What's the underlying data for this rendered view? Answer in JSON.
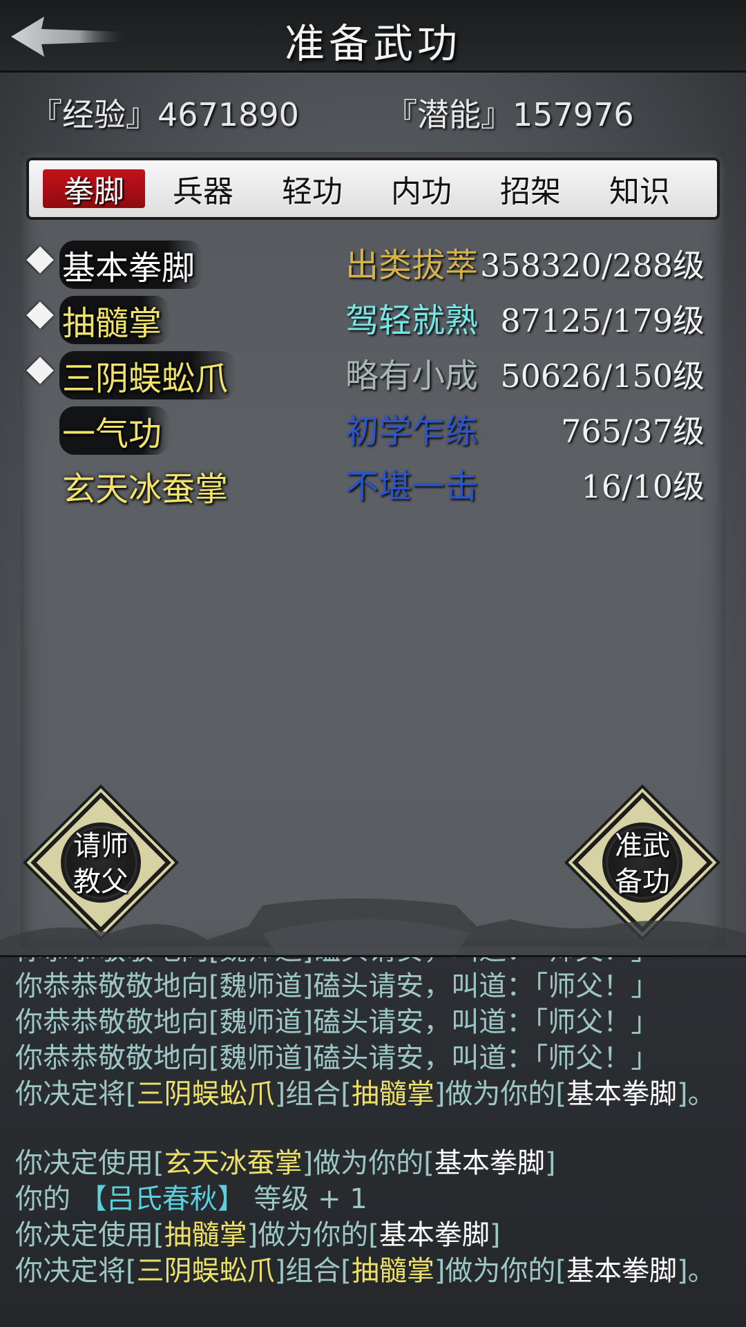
{
  "header": {
    "title": "准备武功",
    "back_icon": "back-arrow-icon"
  },
  "stats": {
    "experience": "『经验』4671890",
    "potential": "『潜能』157976"
  },
  "tabs": [
    {
      "label": "拳脚",
      "active": true
    },
    {
      "label": "兵器",
      "active": false
    },
    {
      "label": "轻功",
      "active": false
    },
    {
      "label": "内功",
      "active": false
    },
    {
      "label": "招架",
      "active": false
    },
    {
      "label": "知识",
      "active": false
    }
  ],
  "skills": [
    {
      "name": "基本拳脚",
      "rank": "出类拔萃",
      "level": "358320/288级",
      "marked": true,
      "name_color": "#ffffff",
      "rank_color": "#d6b24a"
    },
    {
      "name": "抽髓掌",
      "rank": "驾轻就熟",
      "level": "87125/179级",
      "marked": true,
      "name_color": "#f1e36a",
      "rank_color": "#76e6e6"
    },
    {
      "name": "三阴蜈蚣爪",
      "rank": "略有小成",
      "level": "50626/150级",
      "marked": true,
      "name_color": "#f1e36a",
      "rank_color": "#a8b7b6"
    },
    {
      "name": "一气功",
      "rank": "初学乍练",
      "level": "765/37级",
      "marked": false,
      "name_color": "#f1e36a",
      "rank_color": "#2f55c9"
    },
    {
      "name": "玄天冰蚕掌",
      "rank": "不堪一击",
      "level": "16/10级",
      "marked": false,
      "name_color": "#f1e36a",
      "rank_color": "#2b55c7"
    }
  ],
  "buttons": {
    "teacher_line1": "请师",
    "teacher_line2": "教父",
    "prepare_line1": "准武",
    "prepare_line2": "备功"
  },
  "log": {
    "l0": "你恭恭敬敬地向[魏师道]磕头请安，叫道：「师父！」",
    "l1": "你恭恭敬敬地向[魏师道]磕头请安，叫道：「师父！」",
    "l2": "你恭恭敬敬地向[魏师道]磕头请安，叫道：「师父！」",
    "l3": "你恭恭敬敬地向[魏师道]磕头请安，叫道：「师父！」",
    "l4_a": "你决定将[",
    "l4_b": "三阴蜈蚣爪",
    "l4_c": "]组合[",
    "l4_d": "抽髓掌",
    "l4_e": "]做为你的[",
    "l4_f": "基本拳脚",
    "l4_g": "]。",
    "l5_a": "你决定使用[",
    "l5_b": "玄天冰蚕掌",
    "l5_c": "]做为你的[",
    "l5_d": "基本拳脚",
    "l5_e": "]",
    "l6_a": "你的 ",
    "l6_b": "【吕氏春秋】",
    "l6_c": " 等级 + 1",
    "l7_a": "你决定使用[",
    "l7_b": "抽髓掌",
    "l7_c": "]做为你的[",
    "l7_d": "基本拳脚",
    "l7_e": "]",
    "l8_a": "你决定将[",
    "l8_b": "三阴蜈蚣爪",
    "l8_c": "]组合[",
    "l8_d": "抽髓掌",
    "l8_e": "]做为你的[",
    "l8_f": "基本拳脚",
    "l8_g": "]。"
  }
}
